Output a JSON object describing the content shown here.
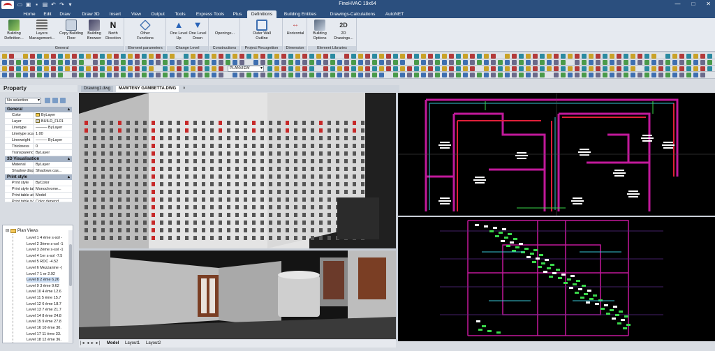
{
  "window": {
    "title": "FineHVAC 19x64",
    "controls": [
      "—",
      "□",
      "✕"
    ]
  },
  "menu": {
    "tabs": [
      "Home",
      "Edit",
      "Draw",
      "Draw 3D",
      "Insert",
      "View",
      "Output",
      "Tools",
      "Express Tools",
      "Plus",
      "Definitions",
      "Building Entities",
      "Drawings-Calculations",
      "AutoNET"
    ],
    "active": "Definitions"
  },
  "ribbon": {
    "groups": [
      {
        "label": "General",
        "buttons": [
          "Building Definition...",
          "Layers Management...",
          "Copy Building Floor",
          "Building Browser",
          "North Direction"
        ]
      },
      {
        "label": "Element parameters",
        "buttons": [
          "Other Functions"
        ]
      },
      {
        "label": "Change Level",
        "buttons": [
          "One Level Up",
          "One Level Down"
        ]
      },
      {
        "label": "Constructions",
        "buttons": [
          "Openings..."
        ]
      },
      {
        "label": "Project Recognition",
        "buttons": [
          "Outer Wall Outline"
        ]
      },
      {
        "label": "Dimension",
        "buttons": [
          "Horizontal"
        ]
      },
      {
        "label": "Element Libraries",
        "buttons": [
          "Building Options",
          "2D Drawings..."
        ]
      }
    ]
  },
  "toolbar": {
    "view_select": "PLANVIEW"
  },
  "property_panel": {
    "title": "Property",
    "selection": "No selection",
    "sections": [
      {
        "name": "General",
        "rows": [
          {
            "key": "Color",
            "value": "ByLayer"
          },
          {
            "key": "Layer",
            "value": "BUILD_FL01"
          },
          {
            "key": "Linetype",
            "value": "——— ByLayer"
          },
          {
            "key": "Linetype scale",
            "value": "1.00"
          },
          {
            "key": "Lineweight",
            "value": "——— ByLayer"
          },
          {
            "key": "Thickness",
            "value": "0"
          },
          {
            "key": "Transparency",
            "value": "ByLayer"
          }
        ]
      },
      {
        "name": "3D Visualisation",
        "rows": [
          {
            "key": "Material",
            "value": "ByLayer"
          },
          {
            "key": "Shadow displ...",
            "value": "Shadows cas..."
          }
        ]
      },
      {
        "name": "Print style",
        "rows": [
          {
            "key": "Print style",
            "value": "ByColor"
          },
          {
            "key": "Print style table",
            "value": "Monochrome..."
          },
          {
            "key": "Print table at...",
            "value": "Model"
          },
          {
            "key": "Print table ty...",
            "value": "Color depend..."
          }
        ]
      }
    ]
  },
  "plan_views": {
    "root": "Plan Views",
    "levels": [
      "Level 1 4 ème s-sol -",
      "Level 2 3ème s-sol -1",
      "Level 3 2ème s-sol -1",
      "Level 4 1er s-sol -7.5",
      "Level 5 RDC -4.52",
      "Level 6 Mezzanine -(",
      "Level 7 1 er 2.92",
      "Level 8 2 ème 6.26",
      "Level 9 3 ème 9.62",
      "Level 10 4 ème 12.6",
      "Level 11 5 ème 15.7",
      "Level 12 6 ème 18.7",
      "Level 13 7 ème 21.7",
      "Level 14 8 ème 24.8",
      "Level 15 9 ème 27.8",
      "Level 16 10 ème 30.",
      "Level 17 11 ème 33.",
      "Level 18 12 ème 36."
    ],
    "selected_index": 7
  },
  "documents": {
    "tabs": [
      "Drawing1.dwg",
      "MAWTENY GAMBETTA.DWG"
    ],
    "active": "MAWTENY GAMBETTA.DWG"
  },
  "layouts": {
    "tabs": [
      "Model",
      "Layout1",
      "Layout2"
    ],
    "active": "Model"
  },
  "colors": {
    "titlebar": "#2b4f7e",
    "ribbon_bg": "#e6eaf0",
    "cad_magenta": "#c2199b",
    "cad_red": "#e0203a",
    "cad_cyan": "#39c6d6",
    "cad_green": "#3ad84a"
  }
}
